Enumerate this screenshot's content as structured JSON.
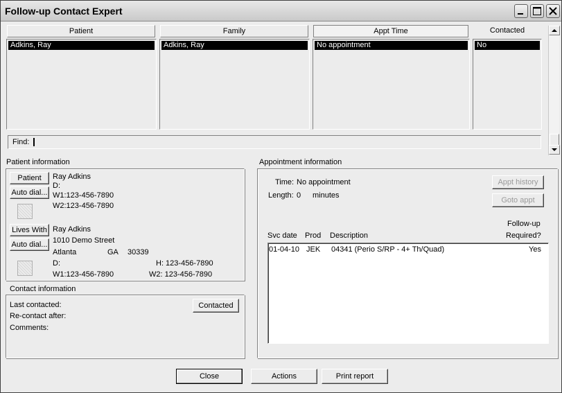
{
  "window": {
    "title": "Follow-up Contact Expert"
  },
  "columns": {
    "patient": {
      "header": "Patient",
      "selected": "Adkins, Ray"
    },
    "family": {
      "header": "Family",
      "selected": "Adkins, Ray"
    },
    "appt_time": {
      "header": "Appt Time",
      "selected": "No appointment"
    },
    "contacted": {
      "header": "Contacted",
      "selected": "No"
    }
  },
  "find": {
    "label": "Find:"
  },
  "patient_info": {
    "group_label": "Patient information",
    "patient_button": "Patient",
    "auto_dial_button": "Auto dial...",
    "name": "Ray Adkins",
    "d_label": "D:",
    "w1": "W1:123-456-7890",
    "w2": "W2:123-456-7890",
    "lives_with_button": "Lives With",
    "lives_with": {
      "name": "Ray Adkins",
      "street": "1010 Demo Street",
      "city": "Atlanta",
      "state": "GA",
      "zip": "30339",
      "d_label": "D:",
      "h": "H: 123-456-7890",
      "w1": "W1:123-456-7890",
      "w2": "W2: 123-456-7890"
    }
  },
  "contact_info": {
    "group_label": "Contact information",
    "last_contacted": "Last contacted:",
    "recontact_after": "Re-contact after:",
    "comments": "Comments:",
    "contacted_button": "Contacted"
  },
  "appointment_info": {
    "group_label": "Appointment information",
    "time_label": "Time:",
    "time_value": "No appointment",
    "length_label": "Length:",
    "length_value": "0",
    "length_unit": "minutes",
    "appt_history_button": "Appt history",
    "goto_appt_button": "Goto appt",
    "table": {
      "headers": {
        "svc_date": "Svc date",
        "prod": "Prod",
        "description": "Description",
        "followup_line1": "Follow-up",
        "followup_line2": "Required?"
      },
      "rows": [
        {
          "svc_date": "01-04-10",
          "prod": "JEK",
          "description": "04341 (Perio S/RP - 4+ Th/Quad)",
          "followup": "Yes"
        }
      ]
    }
  },
  "footer": {
    "close_button": "Close",
    "actions_button": "Actions",
    "print_button": "Print report"
  }
}
